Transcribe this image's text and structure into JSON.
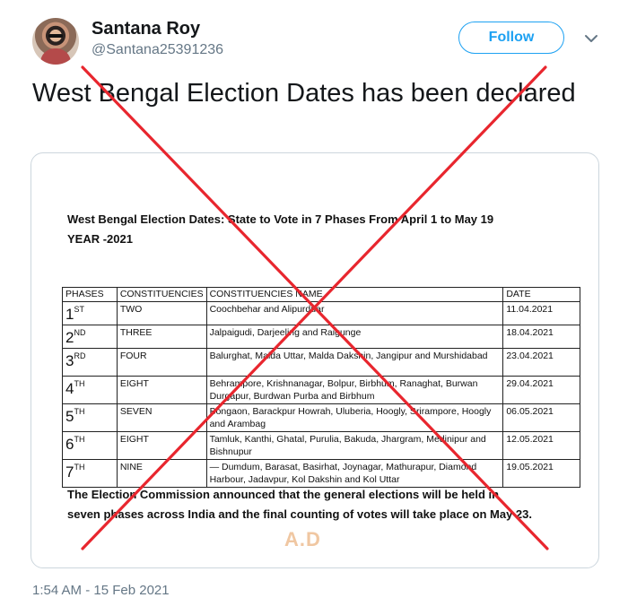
{
  "tweet": {
    "author_name": "Santana Roy",
    "author_handle": "@Santana25391236",
    "follow_label": "Follow",
    "text": "West Bengal Election Dates has been declared",
    "timestamp": "1:54 AM - 15 Feb 2021"
  },
  "document": {
    "title_line1": "West Bengal Election Dates: State to Vote in 7 Phases From April 1 to May 19",
    "title_line2": "YEAR -2021",
    "table_headers": [
      "PHASES",
      "CONSTITUENCIES",
      "CONSTITUENCIES NAME",
      "DATE"
    ],
    "rows": [
      {
        "phase_num": "1",
        "phase_suffix": "ST",
        "count": "TWO",
        "names": "Coochbehar and Alipurduar",
        "date": "11.04.2021"
      },
      {
        "phase_num": "2",
        "phase_suffix": "ND",
        "count": "THREE",
        "names": "Jalpaigudi, Darjeeling and Raigunge",
        "date": "18.04.2021"
      },
      {
        "phase_num": "3",
        "phase_suffix": "RD",
        "count": "FOUR",
        "names": "Balurghat, Malda Uttar, Malda Dakshin, Jangipur and Murshidabad",
        "date": "23.04.2021"
      },
      {
        "phase_num": "4",
        "phase_suffix": "TH",
        "count": "EIGHT",
        "names": "Behrampore, Krishnanagar, Bolpur, Birbhum, Ranaghat, Burwan Durgapur, Burdwan Purba and Birbhum",
        "date": "29.04.2021"
      },
      {
        "phase_num": "5",
        "phase_suffix": "TH",
        "count": "SEVEN",
        "names": "Bongaon, Barackpur Howrah, Uluberia, Hoogly, Srirampore, Hoogly and Arambag",
        "date": "06.05.2021"
      },
      {
        "phase_num": "6",
        "phase_suffix": "TH",
        "count": "EIGHT",
        "names": "Tamluk, Kanthi, Ghatal, Purulia, Bakuda, Jhargram, Medinipur and Bishnupur",
        "date": "12.05.2021"
      },
      {
        "phase_num": "7",
        "phase_suffix": "TH",
        "count": "NINE",
        "names": "— Dumdum, Barasat, Basirhat, Joynagar, Mathurapur, Diamond Harbour, Jadavpur, Kol Dakshin and Kol Uttar",
        "date": "19.05.2021"
      }
    ],
    "footer_line1": "The Election Commission announced that the general elections will be held in",
    "footer_line2": "seven phases across India and the final counting of votes will take place on May 23.",
    "watermark": "A.D"
  },
  "icons": {
    "caret": "chevron-down-icon",
    "overlay": "red-x-cross"
  },
  "colors": {
    "accent": "#1da1f2",
    "cross": "#e8262e",
    "muted_text": "#657786",
    "watermark": "#f0c7a2"
  }
}
